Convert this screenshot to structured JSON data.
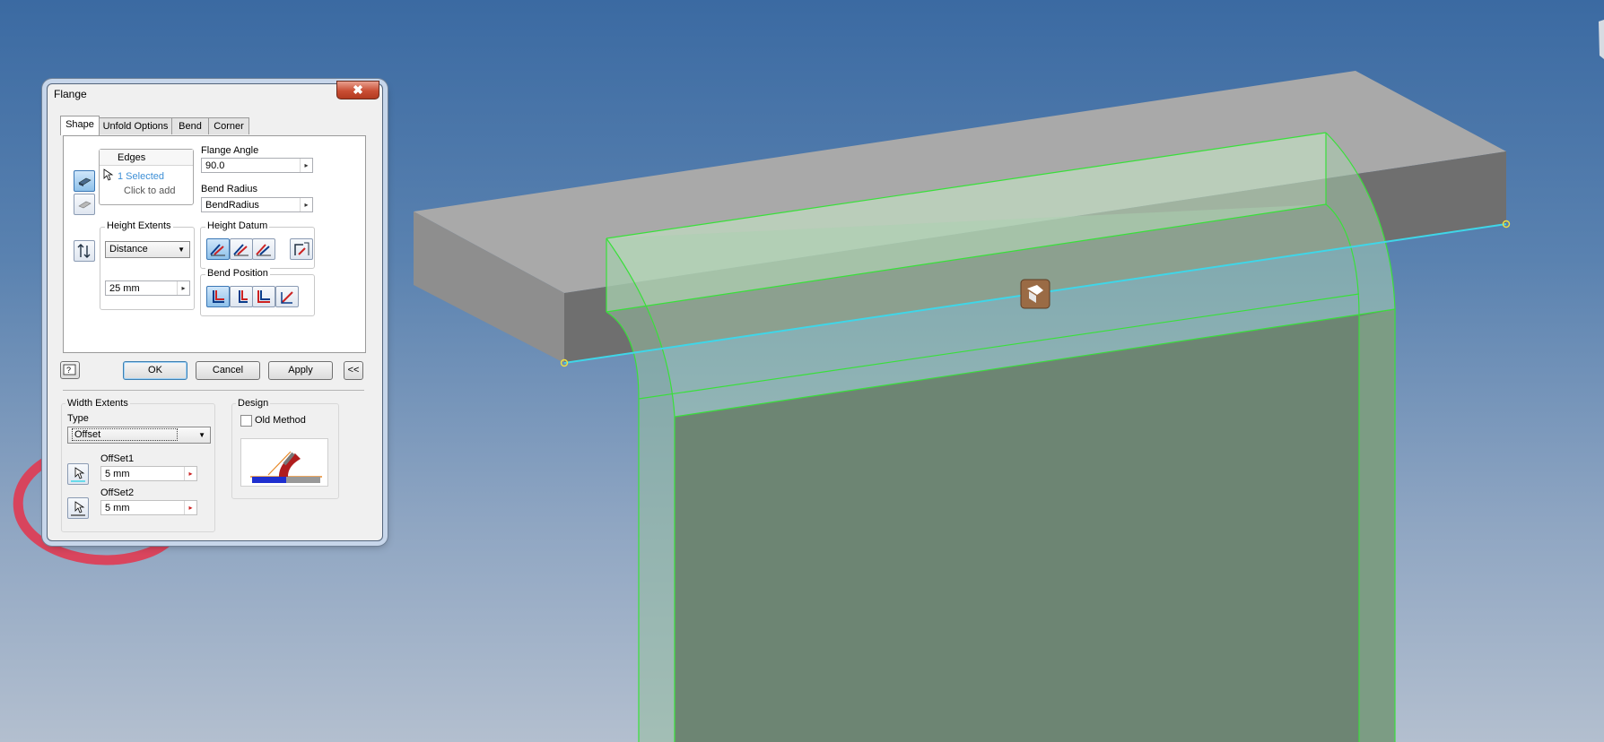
{
  "dialog": {
    "title": "Flange",
    "close_label": "✖",
    "tabs": [
      {
        "label": "Shape",
        "active": true
      },
      {
        "label": "Unfold Options",
        "active": false
      },
      {
        "label": "Bend",
        "active": false
      },
      {
        "label": "Corner",
        "active": false
      }
    ],
    "edges": {
      "header": "Edges",
      "selected": "1 Selected",
      "click_to_add": "Click to add"
    },
    "flange_angle": {
      "label": "Flange Angle",
      "value": "90.0"
    },
    "bend_radius": {
      "label": "Bend Radius",
      "value": "BendRadius"
    },
    "height_extents": {
      "label": "Height Extents",
      "type": "Distance",
      "value": "25 mm"
    },
    "height_datum": {
      "label": "Height Datum"
    },
    "bend_position": {
      "label": "Bend Position"
    },
    "buttons": {
      "help": "?",
      "ok": "OK",
      "cancel": "Cancel",
      "apply": "Apply",
      "collapse": "<<"
    },
    "width_extents": {
      "label": "Width Extents",
      "type_label": "Type",
      "type_value": "Offset",
      "offset1_label": "OffSet1",
      "offset1_value": "5 mm",
      "offset2_label": "OffSet2",
      "offset2_value": "5 mm"
    },
    "design": {
      "label": "Design",
      "old_method_label": "Old Method",
      "old_method_checked": false
    }
  },
  "colors": {
    "selected_edge": "#3fd6e8",
    "preview_edges": "#39e03a",
    "annotation_circle": "#e03a52",
    "bend_glyph": "#9a6b45"
  }
}
